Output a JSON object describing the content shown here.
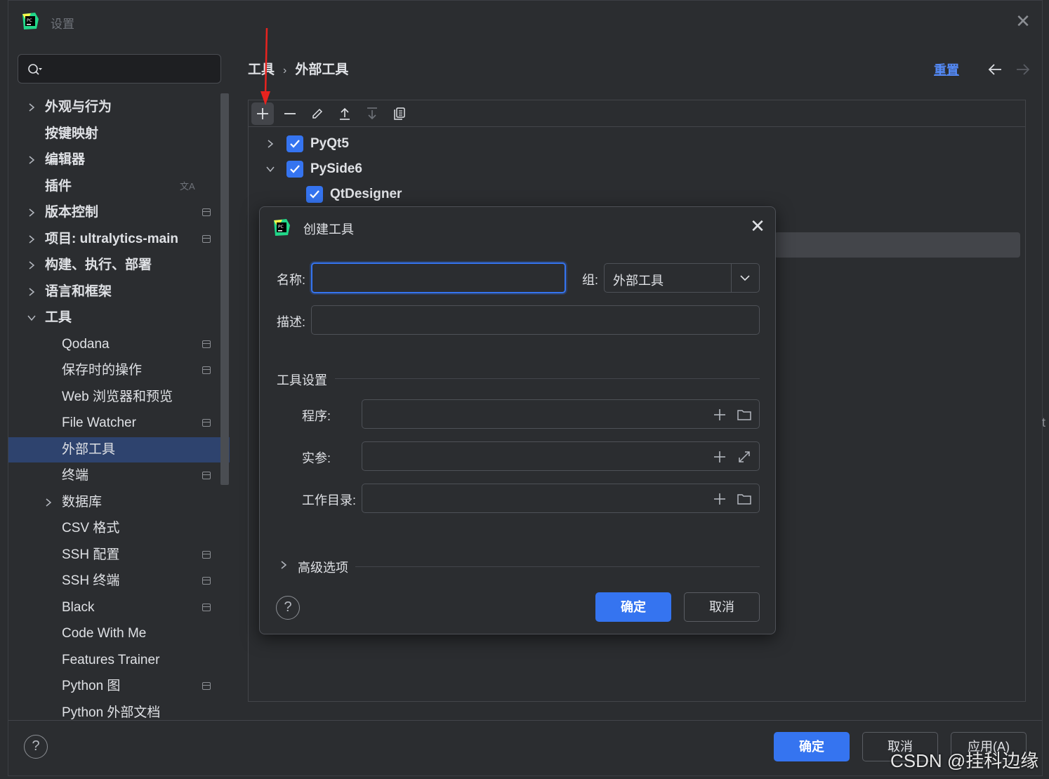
{
  "window": {
    "title": "设置"
  },
  "sidebar": {
    "items": [
      {
        "label": "外观与行为",
        "expand": "collapsed",
        "bold": true,
        "pin": false
      },
      {
        "label": "按键映射",
        "expand": "none",
        "bold": true,
        "pin": false
      },
      {
        "label": "编辑器",
        "expand": "collapsed",
        "bold": true,
        "pin": false
      },
      {
        "label": "插件",
        "expand": "none",
        "bold": true,
        "pin": false,
        "translate_icon": true
      },
      {
        "label": "版本控制",
        "expand": "collapsed",
        "bold": true,
        "pin": true
      },
      {
        "label": "项目: ultralytics-main",
        "expand": "collapsed",
        "bold": true,
        "pin": true
      },
      {
        "label": "构建、执行、部署",
        "expand": "collapsed",
        "bold": true,
        "pin": false
      },
      {
        "label": "语言和框架",
        "expand": "collapsed",
        "bold": true,
        "pin": false
      },
      {
        "label": "工具",
        "expand": "expanded",
        "bold": true,
        "pin": false
      },
      {
        "label": "Qodana",
        "expand": "none",
        "bold": false,
        "pin": true,
        "indent": true
      },
      {
        "label": "保存时的操作",
        "expand": "none",
        "bold": false,
        "pin": true,
        "indent": true
      },
      {
        "label": "Web 浏览器和预览",
        "expand": "none",
        "bold": false,
        "pin": false,
        "indent": true
      },
      {
        "label": "File Watcher",
        "expand": "none",
        "bold": false,
        "pin": true,
        "indent": true
      },
      {
        "label": "外部工具",
        "expand": "none",
        "bold": false,
        "pin": false,
        "indent": true,
        "selected": true
      },
      {
        "label": "终端",
        "expand": "none",
        "bold": false,
        "pin": true,
        "indent": true
      },
      {
        "label": "数据库",
        "expand": "collapsed",
        "bold": false,
        "pin": false,
        "indent": true
      },
      {
        "label": "CSV 格式",
        "expand": "none",
        "bold": false,
        "pin": false,
        "indent": true
      },
      {
        "label": "SSH 配置",
        "expand": "none",
        "bold": false,
        "pin": true,
        "indent": true
      },
      {
        "label": "SSH 终端",
        "expand": "none",
        "bold": false,
        "pin": true,
        "indent": true
      },
      {
        "label": "Black",
        "expand": "none",
        "bold": false,
        "pin": true,
        "indent": true
      },
      {
        "label": "Code With Me",
        "expand": "none",
        "bold": false,
        "pin": false,
        "indent": true
      },
      {
        "label": "Features Trainer",
        "expand": "none",
        "bold": false,
        "pin": false,
        "indent": true
      },
      {
        "label": "Python 图",
        "expand": "none",
        "bold": false,
        "pin": true,
        "indent": true
      },
      {
        "label": "Python 外部文档",
        "expand": "none",
        "bold": false,
        "pin": false,
        "indent": true
      }
    ]
  },
  "breadcrumb": {
    "parent": "工具",
    "separator": "›",
    "current": "外部工具"
  },
  "header": {
    "reset_label": "重置",
    "back_icon": "arrow-left-icon",
    "forward_icon": "arrow-right-icon"
  },
  "toolbar": {
    "icons": [
      "add-icon",
      "remove-icon",
      "edit-icon",
      "move-up-icon",
      "move-down-icon",
      "copy-icon"
    ]
  },
  "tree": [
    {
      "label": "PyQt5",
      "checked": true,
      "expand": "collapsed"
    },
    {
      "label": "PySide6",
      "checked": true,
      "expand": "expanded"
    },
    {
      "label": "QtDesigner",
      "checked": true,
      "expand": "none"
    }
  ],
  "dialog": {
    "title": "创建工具",
    "name_label": "名称:",
    "name_value": "",
    "group_label": "组:",
    "group_value": "外部工具",
    "description_label": "描述:",
    "description_value": "",
    "tool_settings_label": "工具设置",
    "program_label": "程序:",
    "arguments_label": "实参:",
    "working_dir_label": "工作目录:",
    "advanced_label": "高级选项",
    "ok_label": "确定",
    "cancel_label": "取消"
  },
  "footer": {
    "ok_label": "确定",
    "cancel_label": "取消",
    "apply_label": "应用(A)"
  },
  "watermark": "CSDN @挂科边缘",
  "colors": {
    "accent": "#3574f0",
    "selection": "#2e436e",
    "annotation": "#e8231f",
    "link": "#548af7"
  }
}
